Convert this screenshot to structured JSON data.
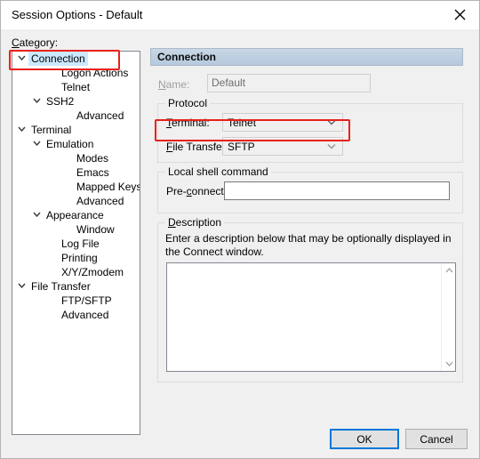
{
  "window": {
    "title": "Session Options - Default",
    "close_icon": "close-icon"
  },
  "category": {
    "label_prefix": "C",
    "label_rest": "ategory:"
  },
  "tree": {
    "items": [
      {
        "label": "Connection",
        "indent": 0,
        "chevron": true,
        "selected": true
      },
      {
        "label": "Logon Actions",
        "indent": 2,
        "chevron": false,
        "selected": false
      },
      {
        "label": "Telnet",
        "indent": 2,
        "chevron": false,
        "selected": false
      },
      {
        "label": "SSH2",
        "indent": 1,
        "chevron": true,
        "selected": false
      },
      {
        "label": "Advanced",
        "indent": 3,
        "chevron": false,
        "selected": false
      },
      {
        "label": "Terminal",
        "indent": 0,
        "chevron": true,
        "selected": false
      },
      {
        "label": "Emulation",
        "indent": 1,
        "chevron": true,
        "selected": false
      },
      {
        "label": "Modes",
        "indent": 3,
        "chevron": false,
        "selected": false
      },
      {
        "label": "Emacs",
        "indent": 3,
        "chevron": false,
        "selected": false
      },
      {
        "label": "Mapped Keys",
        "indent": 3,
        "chevron": false,
        "selected": false
      },
      {
        "label": "Advanced",
        "indent": 3,
        "chevron": false,
        "selected": false
      },
      {
        "label": "Appearance",
        "indent": 1,
        "chevron": true,
        "selected": false
      },
      {
        "label": "Window",
        "indent": 3,
        "chevron": false,
        "selected": false
      },
      {
        "label": "Log File",
        "indent": 2,
        "chevron": false,
        "selected": false
      },
      {
        "label": "Printing",
        "indent": 2,
        "chevron": false,
        "selected": false
      },
      {
        "label": "X/Y/Zmodem",
        "indent": 2,
        "chevron": false,
        "selected": false
      },
      {
        "label": "File Transfer",
        "indent": 0,
        "chevron": true,
        "selected": false
      },
      {
        "label": "FTP/SFTP",
        "indent": 2,
        "chevron": false,
        "selected": false
      },
      {
        "label": "Advanced",
        "indent": 2,
        "chevron": false,
        "selected": false
      }
    ]
  },
  "content": {
    "header": "Connection",
    "name": {
      "label_prefix": "N",
      "label_rest": "ame:",
      "value": "Default",
      "disabled": true
    },
    "protocol": {
      "title": "Protocol",
      "terminal": {
        "label_prefix": "T",
        "label_rest": "erminal:",
        "value": "Telnet"
      },
      "file_transfer": {
        "label_prefix": "F",
        "label_rest": "ile Transfer:",
        "value": "SFTP"
      }
    },
    "local_shell": {
      "title": "Local shell command",
      "preconnect": {
        "label_pre": "Pre-",
        "label_key": "c",
        "label_post": "onnect:",
        "value": "",
        "placeholder": ""
      }
    },
    "description": {
      "title_prefix": "D",
      "title_rest": "escription",
      "help_text": "Enter a description below that may be optionally displayed in the Connect window.",
      "value": "",
      "placeholder": ""
    }
  },
  "buttons": {
    "ok": "OK",
    "cancel": "Cancel"
  },
  "colors": {
    "accent": "#0078d7",
    "annotation": "#e8211c",
    "selection": "#cce8ff",
    "header_bg": "#bdcfe0",
    "dialog_bg": "#f0f0f0"
  }
}
